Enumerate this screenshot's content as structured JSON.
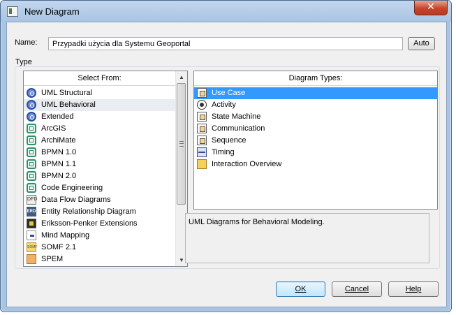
{
  "window": {
    "title": "New Diagram",
    "close_glyph": "✕"
  },
  "name_field": {
    "label": "Name:",
    "value": "Przypadki użycia dla Systemu Geoportal",
    "auto_button": "Auto"
  },
  "type_group": {
    "label": "Type"
  },
  "select_from": {
    "header": "Select From:",
    "items": [
      {
        "label": "UML Structural",
        "icon": "uml-icon"
      },
      {
        "label": "UML Behavioral",
        "icon": "uml-icon",
        "selected": true
      },
      {
        "label": "Extended",
        "icon": "uml-icon"
      },
      {
        "label": "ArcGIS",
        "icon": "technology-icon"
      },
      {
        "label": "ArchiMate",
        "icon": "technology-icon"
      },
      {
        "label": "BPMN 1.0",
        "icon": "technology-icon"
      },
      {
        "label": "BPMN 1.1",
        "icon": "technology-icon"
      },
      {
        "label": "BPMN 2.0",
        "icon": "technology-icon"
      },
      {
        "label": "Code Engineering",
        "icon": "technology-icon"
      },
      {
        "label": "Data Flow Diagrams",
        "icon": "dfd-icon",
        "icon_text": "DFD"
      },
      {
        "label": "Entity Relationship Diagram",
        "icon": "erd-icon",
        "icon_text": "ERD"
      },
      {
        "label": "Eriksson-Penker Extensions",
        "icon": "eriksson-penker-icon"
      },
      {
        "label": "Mind Mapping",
        "icon": "mind-map-icon"
      },
      {
        "label": "SOMF 2.1",
        "icon": "somf-icon",
        "icon_text": "SOMF"
      },
      {
        "label": "SPEM",
        "icon": "spem-icon"
      }
    ]
  },
  "diagram_types": {
    "header": "Diagram Types:",
    "items": [
      {
        "label": "Use Case",
        "icon": "use-case-icon",
        "selected": true
      },
      {
        "label": "Activity",
        "icon": "activity-icon"
      },
      {
        "label": "State Machine",
        "icon": "state-machine-icon"
      },
      {
        "label": "Communication",
        "icon": "communication-icon"
      },
      {
        "label": "Sequence",
        "icon": "sequence-icon"
      },
      {
        "label": "Timing",
        "icon": "timing-icon"
      },
      {
        "label": "Interaction Overview",
        "icon": "interaction-overview-icon"
      }
    ]
  },
  "description": "UML Diagrams for Behavioral Modeling.",
  "buttons": {
    "ok": "OK",
    "cancel": "Cancel",
    "help": "Help"
  },
  "colors": {
    "selection": "#3399ff",
    "window_frame": "#a9c4e2",
    "close_button": "#c9432b"
  }
}
